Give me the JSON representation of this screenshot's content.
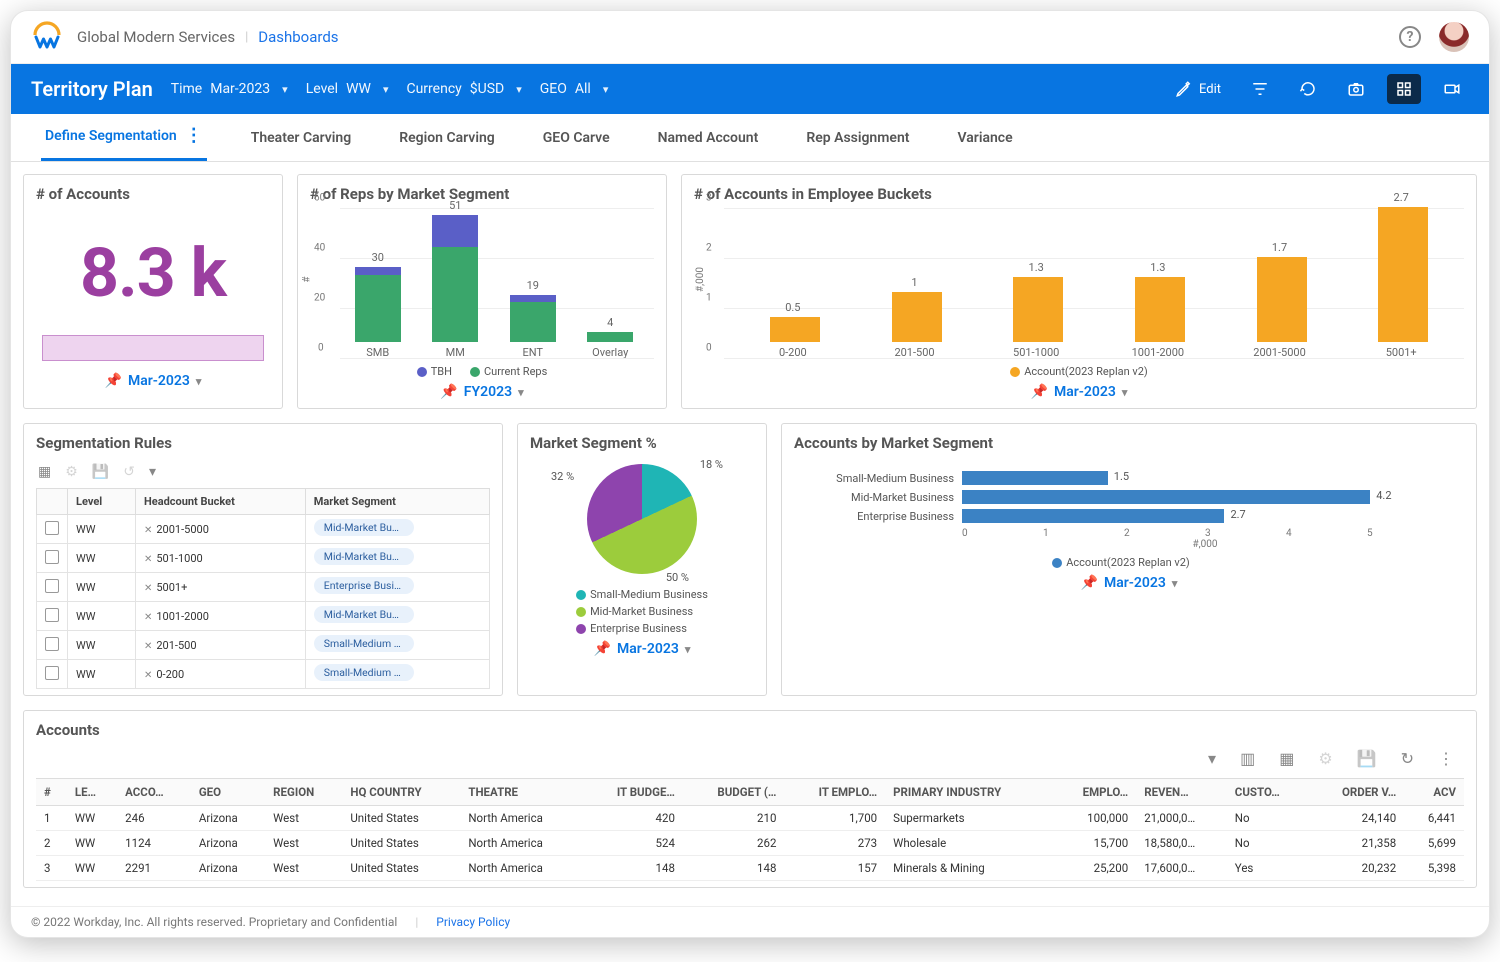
{
  "header": {
    "brand": "Global Modern Services",
    "breadcrumb": "Dashboards"
  },
  "bluebar": {
    "title": "Territory Plan",
    "filters": [
      {
        "label": "Time",
        "value": "Mar-2023"
      },
      {
        "label": "Level",
        "value": "WW"
      },
      {
        "label": "Currency",
        "value": "$USD"
      },
      {
        "label": "GEO",
        "value": "All"
      }
    ],
    "edit_label": "Edit"
  },
  "tabs": [
    "Define Segmentation",
    "Theater Carving",
    "Region Carving",
    "GEO Carve",
    "Named Account",
    "Rep Assignment",
    "Variance"
  ],
  "cards": {
    "accounts_count": {
      "title": "# of Accounts",
      "value": "8.3 k",
      "footer": "Mar-2023"
    },
    "reps_segment": {
      "title": "# of Reps by Market Segment",
      "footer": "FY2023",
      "legend": [
        "TBH",
        "Current Reps"
      ]
    },
    "emp_buckets": {
      "title": "# of Accounts in Employee Buckets",
      "footer": "Mar-2023",
      "legend": "Account(2023 Replan v2)",
      "ylabel": "#,000"
    },
    "rules": {
      "title": "Segmentation Rules",
      "cols": [
        "",
        "Level",
        "Headcount Bucket",
        "Market Segment"
      ],
      "rows": [
        {
          "level": "WW",
          "bucket": "2001-5000",
          "segment": "Mid-Market Busi…"
        },
        {
          "level": "WW",
          "bucket": "501-1000",
          "segment": "Mid-Market Busi…"
        },
        {
          "level": "WW",
          "bucket": "5001+",
          "segment": "Enterprise Busin…"
        },
        {
          "level": "WW",
          "bucket": "1001-2000",
          "segment": "Mid-Market Busi…"
        },
        {
          "level": "WW",
          "bucket": "201-500",
          "segment": "Small-Medium B…"
        },
        {
          "level": "WW",
          "bucket": "0-200",
          "segment": "Small-Medium B…"
        }
      ]
    },
    "pie": {
      "title": "Market Segment %",
      "footer": "Mar-2023",
      "legend": [
        "Small-Medium Business",
        "Mid-Market Business",
        "Enterprise Business"
      ]
    },
    "accounts_seg": {
      "title": "Accounts by Market Segment",
      "footer": "Mar-2023",
      "legend": "Account(2023 Replan v2)",
      "xlabel": "#,000"
    },
    "accounts_table": {
      "title": "Accounts",
      "cols": [
        "#",
        "LE…",
        "ACCO…",
        "GEO",
        "REGION",
        "HQ COUNTRY",
        "THEATRE",
        "IT BUDGE…",
        "BUDGET (…",
        "IT EMPLO…",
        "PRIMARY INDUSTRY",
        "EMPLO…",
        "REVEN…",
        "CUSTO…",
        "ORDER V…",
        "ACV"
      ],
      "rows": [
        [
          "1",
          "WW",
          "246",
          "Arizona",
          "West",
          "United States",
          "North America",
          "420",
          "210",
          "1,700",
          "Supermarkets",
          "100,000",
          "21,000,0…",
          "No",
          "24,140",
          "6,441"
        ],
        [
          "2",
          "WW",
          "1124",
          "Arizona",
          "West",
          "United States",
          "North America",
          "524",
          "262",
          "273",
          "Wholesale",
          "15,700",
          "18,580,0…",
          "No",
          "21,358",
          "5,699"
        ],
        [
          "3",
          "WW",
          "2291",
          "Arizona",
          "West",
          "United States",
          "North America",
          "148",
          "148",
          "157",
          "Minerals & Mining",
          "25,200",
          "17,600,0…",
          "Yes",
          "20,232",
          "5,398"
        ]
      ]
    }
  },
  "chart_data": [
    {
      "type": "bar",
      "id": "reps_by_segment",
      "title": "# of Reps by Market Segment",
      "stacked": true,
      "categories": [
        "SMB",
        "MM",
        "ENT",
        "Overlay"
      ],
      "series": [
        {
          "name": "Current Reps",
          "values": [
            27,
            38,
            16,
            4
          ]
        },
        {
          "name": "TBH",
          "values": [
            3,
            13,
            3,
            0
          ]
        }
      ],
      "totals": [
        30,
        51,
        19,
        4
      ],
      "ylabel": "#",
      "ylim": [
        0,
        60
      ],
      "yticks": [
        0,
        20,
        40,
        60
      ]
    },
    {
      "type": "bar",
      "id": "accounts_employee_buckets",
      "title": "# of Accounts in Employee Buckets",
      "categories": [
        "0-200",
        "201-500",
        "501-1000",
        "1001-2000",
        "2001-5000",
        "5001+"
      ],
      "series": [
        {
          "name": "Account(2023 Replan v2)",
          "values": [
            0.5,
            1.0,
            1.3,
            1.3,
            1.7,
            2.7
          ]
        }
      ],
      "ylabel": "#,000",
      "ylim": [
        0,
        3
      ],
      "yticks": [
        0,
        1,
        2,
        3
      ]
    },
    {
      "type": "pie",
      "id": "market_segment_pct",
      "title": "Market Segment %",
      "slices": [
        {
          "name": "Small-Medium Business",
          "value": 18,
          "color": "#1fb5b5"
        },
        {
          "name": "Mid-Market Business",
          "value": 50,
          "color": "#9ccc3c"
        },
        {
          "name": "Enterprise Business",
          "value": 32,
          "color": "#8e44ad"
        }
      ]
    },
    {
      "type": "bar",
      "id": "accounts_by_segment",
      "orientation": "horizontal",
      "title": "Accounts by Market Segment",
      "categories": [
        "Small-Medium Business",
        "Mid-Market Business",
        "Enterprise Business"
      ],
      "series": [
        {
          "name": "Account(2023 Replan v2)",
          "values": [
            1.5,
            4.2,
            2.7
          ]
        }
      ],
      "xlabel": "#,000",
      "xlim": [
        0,
        5
      ],
      "xticks": [
        0,
        1,
        2,
        3,
        4,
        5
      ]
    }
  ],
  "footer": {
    "copyright": "© 2022 Workday, Inc. All rights reserved. Proprietary and Confidential",
    "link": "Privacy Policy"
  }
}
